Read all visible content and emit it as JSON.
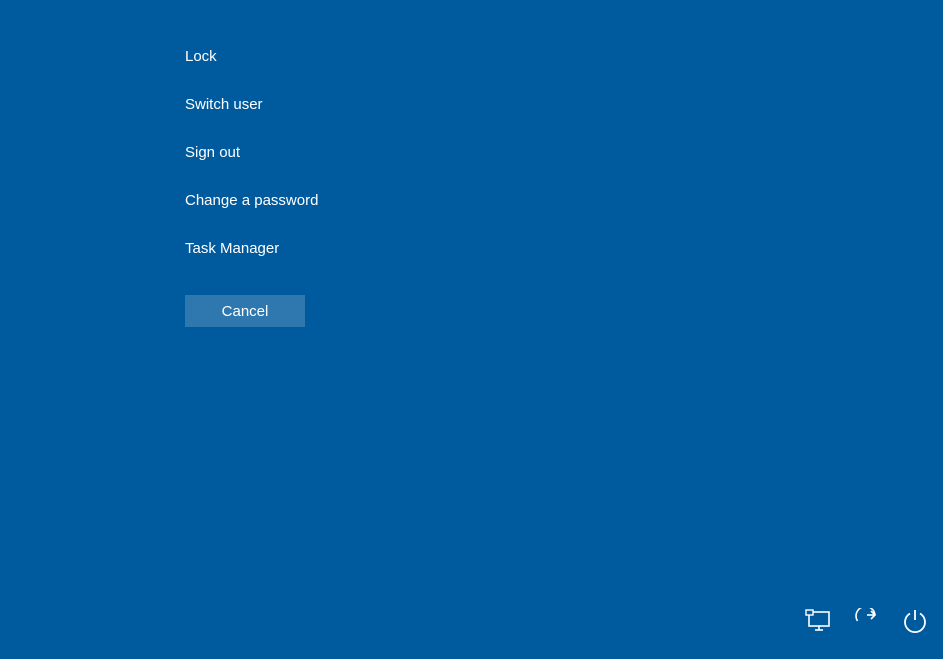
{
  "menu": {
    "items": [
      {
        "label": "Lock"
      },
      {
        "label": "Switch user"
      },
      {
        "label": "Sign out"
      },
      {
        "label": "Change a password"
      },
      {
        "label": "Task Manager"
      }
    ]
  },
  "buttons": {
    "cancel_label": "Cancel"
  },
  "icons": {
    "network": "network-icon",
    "ease_of_access": "ease-of-access-icon",
    "power": "power-icon"
  },
  "colors": {
    "background": "#005a9e",
    "text": "#ffffff",
    "button_bg": "rgba(255,255,255,0.18)"
  }
}
